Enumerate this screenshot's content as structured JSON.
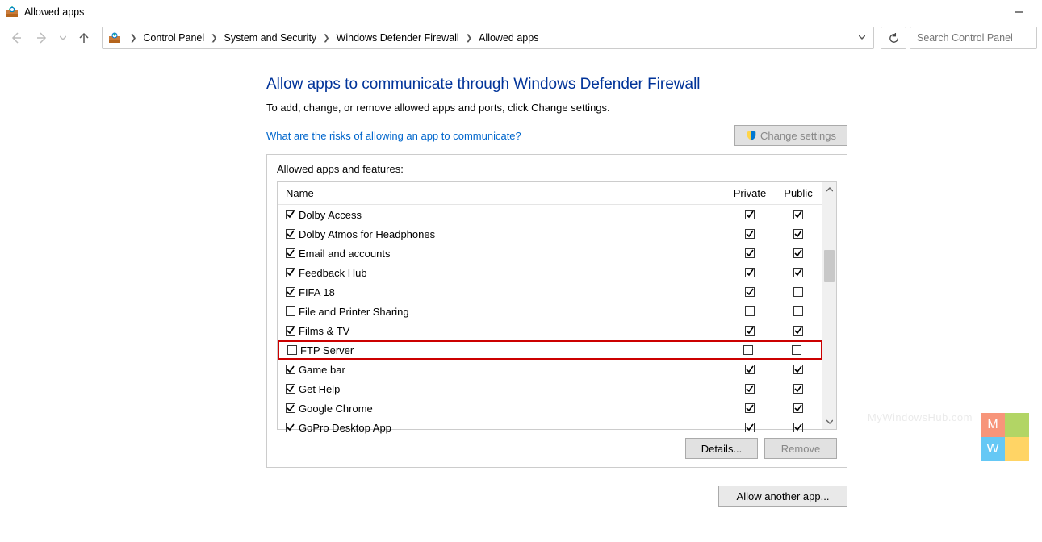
{
  "window": {
    "title": "Allowed apps"
  },
  "breadcrumb": [
    "Control Panel",
    "System and Security",
    "Windows Defender Firewall",
    "Allowed apps"
  ],
  "search": {
    "placeholder": "Search Control Panel"
  },
  "main": {
    "heading": "Allow apps to communicate through Windows Defender Firewall",
    "subtext": "To add, change, or remove allowed apps and ports, click Change settings.",
    "risks_link": "What are the risks of allowing an app to communicate?",
    "change_settings": "Change settings",
    "list_label": "Allowed apps and features:",
    "columns": {
      "name": "Name",
      "private": "Private",
      "public": "Public"
    },
    "rows": [
      {
        "name": "Dolby Access",
        "enabled": true,
        "private": true,
        "public": true,
        "highlight": false
      },
      {
        "name": "Dolby Atmos for Headphones",
        "enabled": true,
        "private": true,
        "public": true,
        "highlight": false
      },
      {
        "name": "Email and accounts",
        "enabled": true,
        "private": true,
        "public": true,
        "highlight": false
      },
      {
        "name": "Feedback Hub",
        "enabled": true,
        "private": true,
        "public": true,
        "highlight": false
      },
      {
        "name": "FIFA 18",
        "enabled": true,
        "private": true,
        "public": false,
        "highlight": false
      },
      {
        "name": "File and Printer Sharing",
        "enabled": false,
        "private": false,
        "public": false,
        "highlight": false
      },
      {
        "name": "Films & TV",
        "enabled": true,
        "private": true,
        "public": true,
        "highlight": false
      },
      {
        "name": "FTP Server",
        "enabled": false,
        "private": false,
        "public": false,
        "highlight": true
      },
      {
        "name": "Game bar",
        "enabled": true,
        "private": true,
        "public": true,
        "highlight": false
      },
      {
        "name": "Get Help",
        "enabled": true,
        "private": true,
        "public": true,
        "highlight": false
      },
      {
        "name": "Google Chrome",
        "enabled": true,
        "private": true,
        "public": true,
        "highlight": false
      },
      {
        "name": "GoPro Desktop App",
        "enabled": true,
        "private": true,
        "public": true,
        "highlight": false
      }
    ],
    "details": "Details...",
    "remove": "Remove",
    "allow_another": "Allow another app..."
  },
  "watermark": {
    "text": "MyWindowsHub.com",
    "letters": [
      "M",
      "",
      "W",
      ""
    ]
  }
}
